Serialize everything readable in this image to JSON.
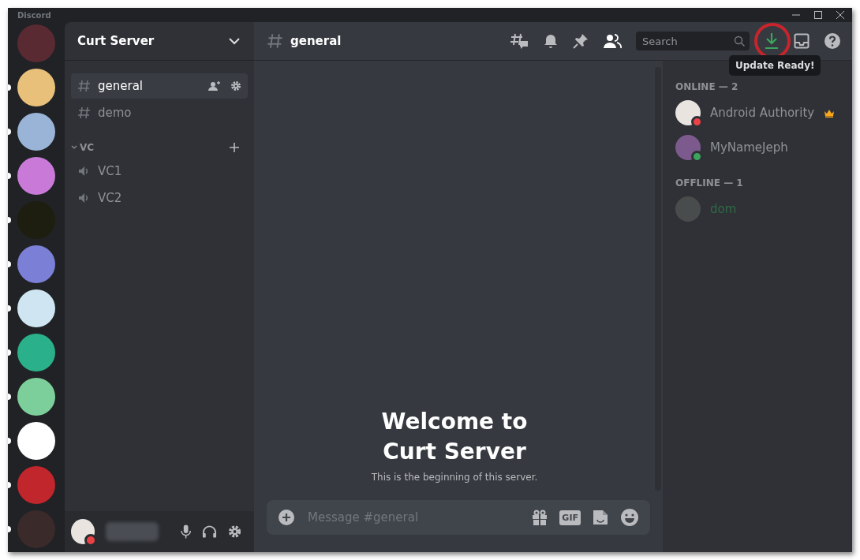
{
  "window": {
    "title": "Discord"
  },
  "servers": [
    {
      "unread": false
    },
    {
      "unread": true
    },
    {
      "unread": true
    },
    {
      "unread": true
    },
    {
      "unread": true
    },
    {
      "unread": true
    },
    {
      "unread": true
    },
    {
      "unread": true
    },
    {
      "unread": true
    },
    {
      "unread": true
    },
    {
      "unread": true
    },
    {
      "unread": true
    }
  ],
  "sidebar": {
    "server_name": "Curt Server",
    "channels": [
      {
        "kind": "text",
        "name": "general",
        "selected": true
      },
      {
        "kind": "text",
        "name": "demo",
        "selected": false
      },
      {
        "kind": "category",
        "name": "VC",
        "expanded": true,
        "children": [
          {
            "kind": "voice",
            "name": "VC1",
            "selected": false
          },
          {
            "kind": "voice",
            "name": "VC2",
            "selected": false
          }
        ]
      }
    ]
  },
  "user_panel": {
    "color": "#ed4245"
  },
  "header": {
    "channel": "general",
    "search": {
      "placeholder": "Search"
    },
    "update_highlighted": true,
    "tooltip": "Update Ready!"
  },
  "chat": {
    "welcome_title": "Welcome to Curt Server",
    "welcome_text": "This is the beginning of this server.",
    "message": {
      "placeholder": "Message #general"
    },
    "gif_label": "GIF"
  },
  "members": [
    {
      "label": "ONLINE — 2",
      "members": [
        {
          "name": "Android Authority",
          "offline": false,
          "color": "#ed4245",
          "owner": true
        },
        {
          "name": "MyNameJeph",
          "offline": false,
          "color": "#3ba55d",
          "owner": false
        }
      ]
    },
    {
      "label": "OFFLINE — 1",
      "members": [
        {
          "name": "dom",
          "offline": true,
          "color": "#2e6b46",
          "owner": false
        }
      ]
    }
  ]
}
